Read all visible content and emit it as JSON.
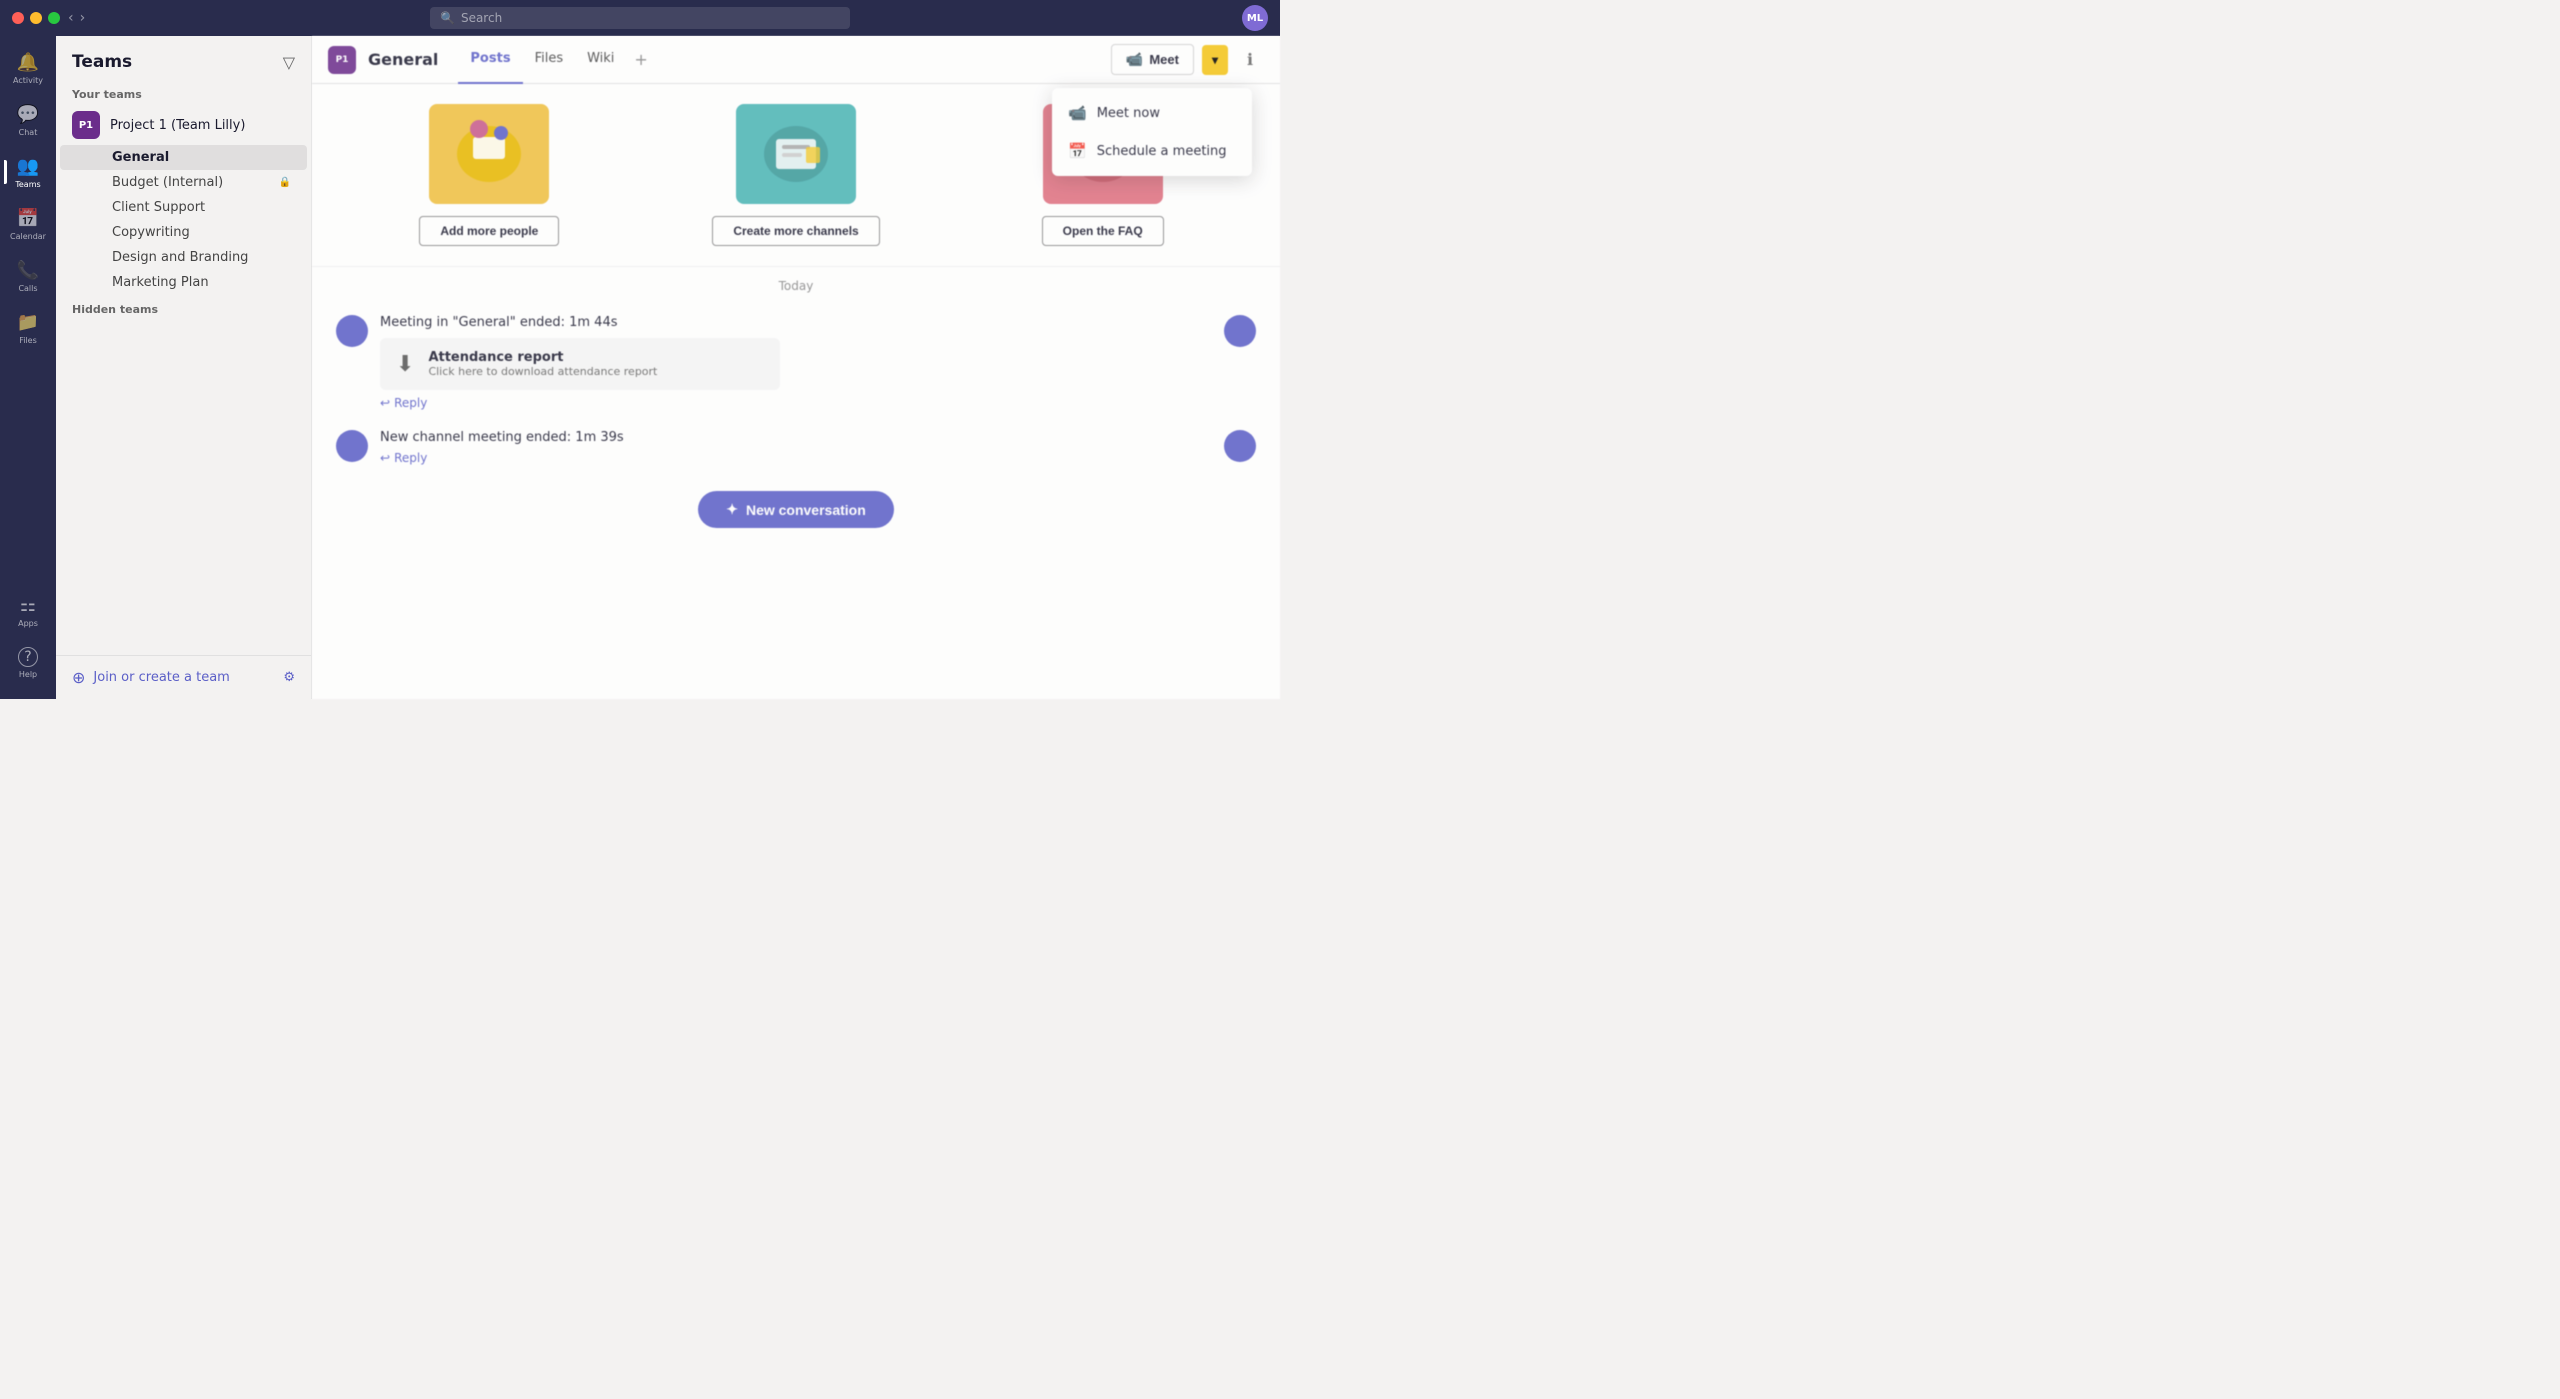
{
  "titlebar": {
    "dots": [
      "red",
      "yellow",
      "green"
    ],
    "search_placeholder": "Search",
    "avatar_initials": "ML",
    "back_arrow": "‹",
    "forward_arrow": "›"
  },
  "sidebar": {
    "items": [
      {
        "id": "activity",
        "label": "Activity",
        "glyph": "🔔"
      },
      {
        "id": "chat",
        "label": "Chat",
        "glyph": "💬"
      },
      {
        "id": "teams",
        "label": "Teams",
        "glyph": "👥"
      },
      {
        "id": "calendar",
        "label": "Calendar",
        "glyph": "📅"
      },
      {
        "id": "calls",
        "label": "Calls",
        "glyph": "📞"
      },
      {
        "id": "files",
        "label": "Files",
        "glyph": "📁"
      }
    ],
    "bottom_items": [
      {
        "id": "apps",
        "label": "Apps",
        "glyph": "⚏"
      },
      {
        "id": "help",
        "label": "Help",
        "glyph": "?"
      }
    ]
  },
  "teams_panel": {
    "title": "Teams",
    "your_teams_label": "Your teams",
    "team": {
      "avatar": "P1",
      "name": "Project 1 (Team Lilly)",
      "channels": [
        {
          "name": "General",
          "active": true
        },
        {
          "name": "Budget (Internal)",
          "locked": true
        },
        {
          "name": "Client Support"
        },
        {
          "name": "Copywriting"
        },
        {
          "name": "Design and Branding"
        },
        {
          "name": "Marketing Plan"
        }
      ]
    },
    "hidden_teams_label": "Hidden teams",
    "join_label": "Join or create a team",
    "join_icon": "⊕",
    "settings_icon": "⚙"
  },
  "channel_header": {
    "avatar": "P1",
    "name": "General",
    "tabs": [
      {
        "label": "Posts",
        "active": true
      },
      {
        "label": "Files"
      },
      {
        "label": "Wiki"
      }
    ],
    "tab_add": "+",
    "meet_label": "Meet",
    "meet_icon": "📹",
    "dropdown_icon": "▾",
    "info_icon": "ℹ"
  },
  "meet_dropdown": {
    "items": [
      {
        "id": "meet-now",
        "label": "Meet now",
        "icon": "📹"
      },
      {
        "id": "schedule-meeting",
        "label": "Schedule a meeting",
        "icon": "📅"
      }
    ]
  },
  "cards": [
    {
      "type": "yellow",
      "btn_label": "Add more people"
    },
    {
      "type": "teal",
      "btn_label": "Create more channels"
    },
    {
      "type": "pink",
      "btn_label": "Open the FAQ"
    }
  ],
  "date_separator": "Today",
  "messages": [
    {
      "id": "msg1",
      "text": "Meeting in \"General\" ended: 1m 44s",
      "has_card": true,
      "card_title": "Attendance report",
      "card_sub": "Click here to download attendance report",
      "reply_label": "Reply"
    },
    {
      "id": "msg2",
      "text": "New channel meeting ended: 1m 39s",
      "has_card": false,
      "reply_label": "Reply"
    }
  ],
  "new_conversation": {
    "label": "New conversation",
    "icon": "✦"
  }
}
